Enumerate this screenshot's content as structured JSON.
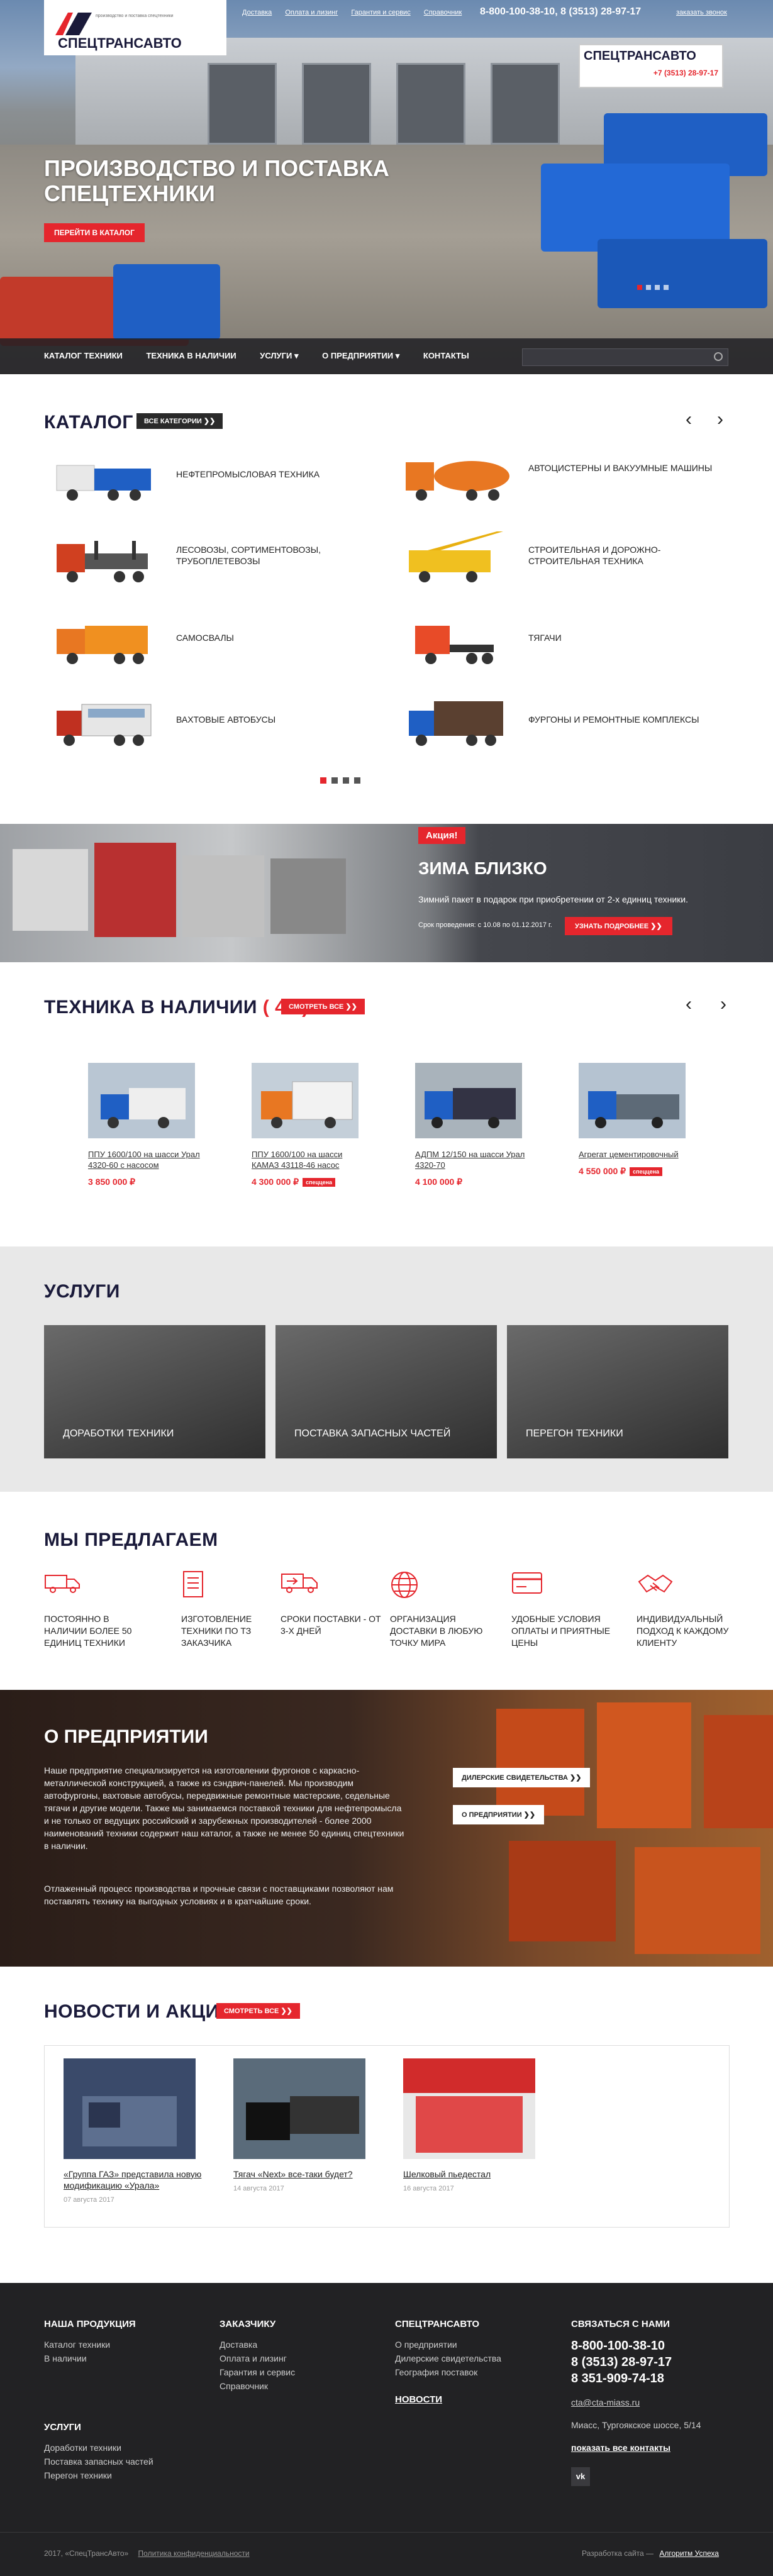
{
  "header": {
    "logo_text": "СПЕЦТРАНСАВТО",
    "logo_subtitle": "производство и поставка спецтехники",
    "nav": [
      "Доставка",
      "Оплата и лизинг",
      "Гарантия и сервис",
      "Справочник"
    ],
    "phones": "8-800-100-38-10, 8 (3513) 28-97-17",
    "callback": "заказать звонок"
  },
  "hero": {
    "title": "Производство и поставка спецтехники",
    "cta": "Перейти в каталог",
    "sign_text": "СПЕЦТРАНСАВТО",
    "sign_phone": "+7 (3513) 28-97-17"
  },
  "mainnav": {
    "items": [
      "Каталог техники",
      "Техника в наличии",
      "Услуги ▾",
      "О предприятии ▾",
      "Контакты"
    ],
    "search_placeholder": ""
  },
  "catalog": {
    "title": "Каталог",
    "all_btn": "Все категории",
    "items": [
      {
        "label": "Нефтепромысловая техника"
      },
      {
        "label": "Автоцистерны и вакуумные машины"
      },
      {
        "label": "Лесовозы, сортиментовозы, трубоплетевозы"
      },
      {
        "label": "Строительная и дорожно-строительная техника"
      },
      {
        "label": "Самосвалы"
      },
      {
        "label": "Тягачи"
      },
      {
        "label": "Вахтовые автобусы"
      },
      {
        "label": "Фургоны и ремонтные комплексы"
      }
    ]
  },
  "promo": {
    "badge": "Акция!",
    "title": "Зима близко",
    "text": "Зимний пакет в подарок при приобретении от 2-х единиц техники.",
    "date": "Срок проведения: с 10.08 по 01.12.2017 г.",
    "btn": "Узнать подробнее"
  },
  "stock": {
    "title": "Техника в наличии",
    "count": "( 45 )",
    "btn": "Смотреть все",
    "items": [
      {
        "name": "ППУ 1600/100 на шасси Урал 4320-60 с насосом",
        "price": "3 850 000 ₽",
        "tag": ""
      },
      {
        "name": "ППУ 1600/100 на шасси КАМАЗ 43118-46 насос",
        "price": "4 300 000 ₽",
        "tag": "спеццена"
      },
      {
        "name": "АДПМ 12/150 на шасси Урал 4320-70",
        "price": "4 100 000 ₽",
        "tag": ""
      },
      {
        "name": "Агрегат цементировочный",
        "price": "4 550 000 ₽",
        "tag": "спеццена"
      }
    ]
  },
  "services": {
    "title": "Услуги",
    "items": [
      "Доработки техники",
      "Поставка запасных частей",
      "Перегон техники"
    ]
  },
  "offer": {
    "title": "Мы предлагаем",
    "items": [
      {
        "text": "Постоянно в наличии более 50 единиц техники",
        "icon": "truck-icon"
      },
      {
        "text": "Изготовление техники по ТЗ заказчика",
        "icon": "document-icon"
      },
      {
        "text": "Сроки поставки - от 3-х дней",
        "icon": "delivery-icon"
      },
      {
        "text": "Организация доставки в любую точку мира",
        "icon": "globe-icon"
      },
      {
        "text": "Удобные условия оплаты и приятные цены",
        "icon": "card-icon"
      },
      {
        "text": "Индивидуальный подход к каждому клиенту",
        "icon": "handshake-icon"
      }
    ]
  },
  "about": {
    "title": "О предприятии",
    "p1": "Наше предприятие специализируется на изготовлении фургонов с каркасно-металлической конструкцией, а также из сэндвич-панелей. Мы производим автофургоны, вахтовые автобусы, передвижные ремонтные мастерские, седельные тягачи и другие модели. Также мы занимаемся поставкой техники для нефтепромысла и не только от ведущих российский и зарубежных производителей - более 2000 наименований техники содержит наш каталог, а также не менее 50 единиц  спецтехники в наличии.",
    "p2": "Отлаженный процесс производства и прочные связи с поставщиками позволяют нам поставлять технику на выгодных условиях и в кратчайшие сроки.",
    "btn1": "Дилерские свидетельства",
    "btn2": "О предприятии"
  },
  "news": {
    "title": "Новости и акции",
    "btn": "Смотреть все",
    "items": [
      {
        "title": "«Группа ГАЗ» представила новую модификацию «Урала»",
        "date": "07 августа 2017"
      },
      {
        "title": "Тягач «Next» все-таки будет?",
        "date": "14 августа 2017"
      },
      {
        "title": "Шелковый пьедестал",
        "date": "16 августа 2017"
      }
    ]
  },
  "footer": {
    "col1_title": "Наша продукция",
    "col1": [
      "Каталог техники",
      "В наличии"
    ],
    "col1b_title": "Услуги",
    "col1b": [
      "Доработки техники",
      "Поставка запасных частей",
      "Перегон техники"
    ],
    "col2_title": "Заказчику",
    "col2": [
      "Доставка",
      "Оплата и лизинг",
      "Гарантия и сервис",
      "Справочник"
    ],
    "col3_title": "СпецТрансАвто",
    "col3": [
      "О предприятии",
      "Дилерские свидетельства",
      "География поставок"
    ],
    "col3_news": "Новости",
    "col4_title": "Связаться с нами",
    "phone1": "8-800-100-38-10",
    "phone2": "8 (3513) 28-97-17",
    "phone3": "8 351-909-74-18",
    "email": "cta@cta-miass.ru",
    "address": "Миасс, Тургоякское шоссе, 5/14",
    "all_contacts": "показать все контакты",
    "copyright": "2017, «СпецТрансАвто»",
    "privacy": "Политика конфиденциальности",
    "dev_label": "Разработка сайта —",
    "dev_name": "Алгоритм Успеха",
    "social_icon": "vk-icon"
  },
  "colors": {
    "accent": "#e5262d",
    "dark": "#222224",
    "navy": "#1a1a3a"
  }
}
